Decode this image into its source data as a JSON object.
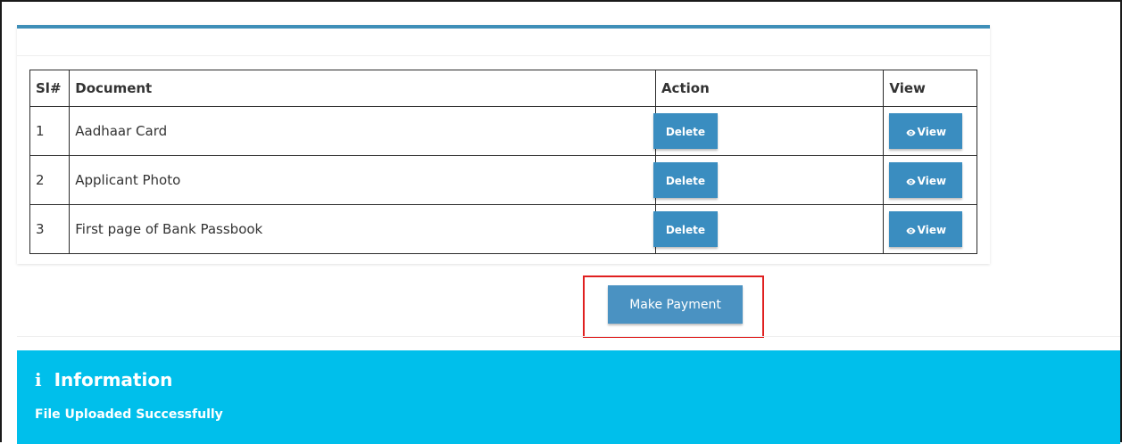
{
  "table": {
    "headers": {
      "sl": "Sl#",
      "document": "Document",
      "action": "Action",
      "view": "View"
    },
    "rows": [
      {
        "sl": "1",
        "document": "Aadhaar Card",
        "delete_label": "Delete",
        "view_label": "View"
      },
      {
        "sl": "2",
        "document": "Applicant Photo",
        "delete_label": "Delete",
        "view_label": "View"
      },
      {
        "sl": "3",
        "document": "First page of Bank Passbook",
        "delete_label": "Delete",
        "view_label": "View"
      }
    ]
  },
  "payment": {
    "button_label": "Make Payment",
    "highlight_color": "#e02020"
  },
  "info": {
    "icon": "info-icon",
    "title": "Information",
    "message": "File Uploaded Successfully",
    "background_color": "#00bfeb"
  },
  "colors": {
    "accent": "#3f8fb8",
    "button": "#3a8dc0"
  }
}
